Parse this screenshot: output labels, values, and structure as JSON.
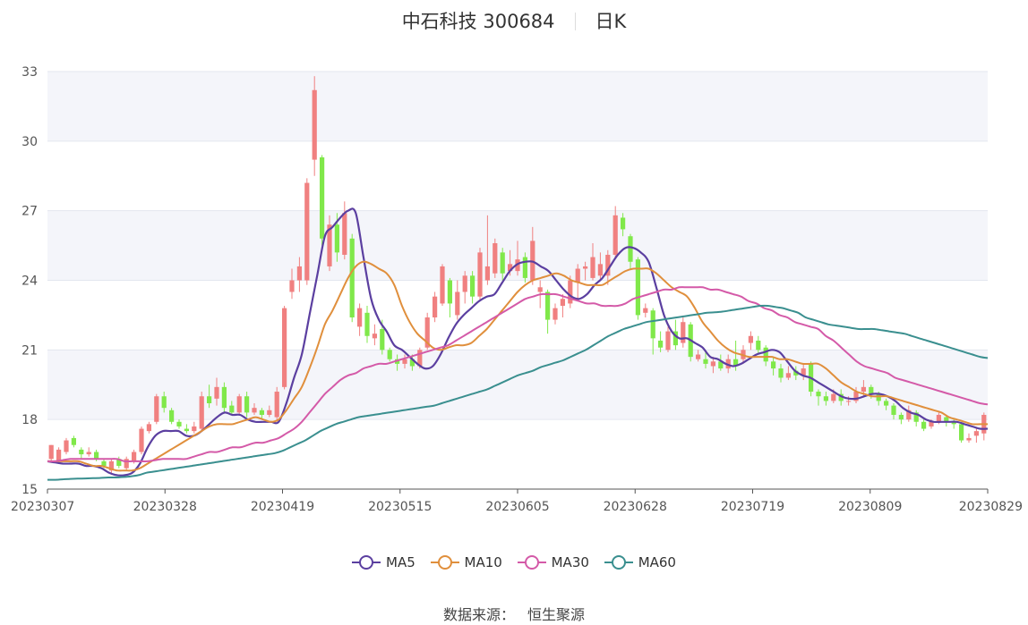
{
  "header": {
    "title": "中石科技 300684",
    "period": "日K"
  },
  "source": {
    "label": "数据来源：",
    "value": "恒生聚源"
  },
  "chart_data": {
    "type": "candlestick",
    "ylim": [
      15,
      33
    ],
    "yticks": [
      "15",
      "18",
      "21",
      "24",
      "27",
      "30",
      "33"
    ],
    "xticks": [
      "20230307",
      "20230328",
      "20230419",
      "20230515",
      "20230605",
      "20230628",
      "20230719",
      "20230809",
      "20230829"
    ],
    "grid": true,
    "legend_position": "bottom-center",
    "colors": {
      "up": "#f08080",
      "down": "#80e84a",
      "MA5": "#5b3fa0",
      "MA10": "#e08f3c",
      "MA30": "#d45aa8",
      "MA60": "#3a8f8f",
      "band": "#f4f5fa"
    },
    "series": [
      {
        "name": "MA5",
        "values": [
          16.2,
          16.15,
          16.1,
          16.1,
          16.1,
          16.0,
          16.0,
          15.9,
          15.7,
          15.6,
          15.6,
          15.7,
          16.1,
          16.8,
          17.3,
          17.5,
          17.5,
          17.5,
          17.3,
          17.3,
          17.5,
          17.8,
          18.1,
          18.3,
          18.2,
          18.2,
          18.0,
          17.9,
          17.9,
          17.9,
          17.9,
          18.7,
          19.8,
          20.8,
          22.5,
          24.2,
          25.9,
          26.3,
          26.7,
          27.0,
          26.9,
          25.0,
          23.2,
          22.3,
          21.8,
          21.2,
          21.0,
          20.7,
          20.4,
          20.2,
          20.3,
          20.8,
          21.5,
          22.1,
          22.5,
          22.8,
          23.1,
          23.3,
          23.4,
          23.9,
          24.4,
          24.7,
          24.8,
          24.8,
          24.6,
          24.4,
          24.0,
          23.6,
          23.3,
          23.2,
          23.4,
          23.8,
          24.1,
          24.6,
          25.1,
          25.4,
          25.4,
          25.2,
          24.8,
          23.7,
          22.5,
          21.8,
          21.5,
          21.5,
          21.3,
          21.1,
          20.7,
          20.6,
          20.4,
          20.3,
          20.4,
          20.6,
          20.8,
          20.9,
          21.0,
          20.9,
          20.5,
          20.1,
          19.9,
          19.8,
          19.6,
          19.4,
          19.2,
          19.0,
          18.9,
          18.9,
          19.0,
          19.1,
          19.1,
          19.0,
          18.8,
          18.5,
          18.3,
          18.2,
          18.0,
          17.9,
          17.9,
          17.9,
          17.9,
          17.8,
          17.7,
          17.6,
          17.6
        ]
      },
      {
        "name": "MA10",
        "values": [
          16.2,
          16.2,
          16.2,
          16.2,
          16.2,
          16.1,
          16.0,
          16.0,
          15.9,
          15.8,
          15.8,
          15.8,
          15.9,
          16.1,
          16.3,
          16.5,
          16.7,
          16.9,
          17.1,
          17.3,
          17.5,
          17.7,
          17.8,
          17.8,
          17.8,
          17.9,
          18.0,
          18.1,
          18.0,
          17.9,
          18.0,
          18.4,
          18.9,
          19.4,
          20.2,
          21.1,
          22.1,
          22.7,
          23.4,
          24.1,
          24.6,
          24.8,
          24.7,
          24.5,
          24.3,
          23.8,
          22.9,
          22.2,
          21.7,
          21.4,
          21.1,
          21.0,
          21.1,
          21.2,
          21.2,
          21.3,
          21.6,
          21.9,
          22.3,
          22.7,
          23.1,
          23.5,
          23.8,
          24.0,
          24.1,
          24.2,
          24.3,
          24.2,
          24.0,
          23.9,
          23.8,
          23.8,
          23.8,
          24.0,
          24.2,
          24.4,
          24.5,
          24.5,
          24.5,
          24.3,
          24.0,
          23.7,
          23.5,
          23.3,
          22.8,
          22.2,
          21.8,
          21.4,
          21.1,
          20.9,
          20.8,
          20.7,
          20.7,
          20.7,
          20.7,
          20.6,
          20.6,
          20.5,
          20.4,
          20.4,
          20.4,
          20.2,
          19.9,
          19.6,
          19.4,
          19.2,
          19.1,
          19.0,
          19.0,
          19.0,
          18.9,
          18.8,
          18.7,
          18.6,
          18.5,
          18.4,
          18.3,
          18.1,
          18.0,
          17.9,
          17.8,
          17.8,
          17.8
        ]
      },
      {
        "name": "MA30",
        "values": [
          16.2,
          16.2,
          16.25,
          16.3,
          16.3,
          16.3,
          16.3,
          16.3,
          16.3,
          16.3,
          16.2,
          16.2,
          16.2,
          16.2,
          16.25,
          16.3,
          16.3,
          16.3,
          16.3,
          16.4,
          16.5,
          16.6,
          16.6,
          16.7,
          16.8,
          16.8,
          16.9,
          17.0,
          17.0,
          17.1,
          17.2,
          17.4,
          17.6,
          17.9,
          18.3,
          18.7,
          19.1,
          19.4,
          19.7,
          19.9,
          20.0,
          20.2,
          20.3,
          20.4,
          20.4,
          20.5,
          20.6,
          20.7,
          20.8,
          20.9,
          21.0,
          21.1,
          21.2,
          21.4,
          21.6,
          21.8,
          22.0,
          22.2,
          22.4,
          22.6,
          22.8,
          23.0,
          23.2,
          23.3,
          23.4,
          23.4,
          23.4,
          23.3,
          23.2,
          23.1,
          23.0,
          23.0,
          22.9,
          22.9,
          22.9,
          23.0,
          23.2,
          23.3,
          23.4,
          23.5,
          23.6,
          23.6,
          23.7,
          23.7,
          23.7,
          23.7,
          23.6,
          23.6,
          23.5,
          23.4,
          23.3,
          23.1,
          23.0,
          22.8,
          22.7,
          22.5,
          22.4,
          22.2,
          22.1,
          22.0,
          21.9,
          21.6,
          21.4,
          21.1,
          20.8,
          20.5,
          20.3,
          20.2,
          20.1,
          20.0,
          19.8,
          19.7,
          19.6,
          19.5,
          19.4,
          19.3,
          19.2,
          19.1,
          19.0,
          18.9,
          18.8,
          18.7,
          18.65
        ]
      },
      {
        "name": "MA60",
        "values": [
          15.4,
          15.4,
          15.42,
          15.44,
          15.45,
          15.46,
          15.47,
          15.48,
          15.5,
          15.5,
          15.52,
          15.55,
          15.6,
          15.7,
          15.75,
          15.8,
          15.85,
          15.9,
          15.95,
          16.0,
          16.05,
          16.1,
          16.15,
          16.2,
          16.25,
          16.3,
          16.35,
          16.4,
          16.45,
          16.5,
          16.55,
          16.65,
          16.8,
          16.95,
          17.1,
          17.3,
          17.5,
          17.65,
          17.8,
          17.9,
          18.0,
          18.1,
          18.15,
          18.2,
          18.25,
          18.3,
          18.35,
          18.4,
          18.45,
          18.5,
          18.55,
          18.6,
          18.7,
          18.8,
          18.9,
          19.0,
          19.1,
          19.2,
          19.3,
          19.45,
          19.6,
          19.75,
          19.9,
          20.0,
          20.1,
          20.25,
          20.35,
          20.45,
          20.55,
          20.7,
          20.85,
          21.0,
          21.2,
          21.4,
          21.6,
          21.75,
          21.9,
          22.0,
          22.1,
          22.2,
          22.25,
          22.3,
          22.35,
          22.4,
          22.45,
          22.5,
          22.55,
          22.6,
          22.62,
          22.65,
          22.7,
          22.75,
          22.8,
          22.85,
          22.9,
          22.9,
          22.85,
          22.8,
          22.7,
          22.6,
          22.4,
          22.3,
          22.2,
          22.1,
          22.05,
          22.0,
          21.95,
          21.9,
          21.9,
          21.9,
          21.85,
          21.8,
          21.75,
          21.7,
          21.6,
          21.5,
          21.4,
          21.3,
          21.2,
          21.1,
          21.0,
          20.9,
          20.8,
          20.7,
          20.65
        ]
      }
    ],
    "candles": [
      [
        16.3,
        16.9,
        16.9,
        16.2
      ],
      [
        16.2,
        16.7,
        16.8,
        16.1
      ],
      [
        16.6,
        17.1,
        17.2,
        16.5
      ],
      [
        17.2,
        16.9,
        17.3,
        16.8
      ],
      [
        16.7,
        16.5,
        16.8,
        16.3
      ],
      [
        16.5,
        16.6,
        16.8,
        16.4
      ],
      [
        16.6,
        16.3,
        16.7,
        16.2
      ],
      [
        16.2,
        16.0,
        16.3,
        15.9
      ],
      [
        15.8,
        16.2,
        16.3,
        15.7
      ],
      [
        16.3,
        16.0,
        16.4,
        15.9
      ],
      [
        15.9,
        16.3,
        16.4,
        15.8
      ],
      [
        16.2,
        16.6,
        16.7,
        16.1
      ],
      [
        16.6,
        17.6,
        17.7,
        16.5
      ],
      [
        17.5,
        17.8,
        17.9,
        17.4
      ],
      [
        17.9,
        19.0,
        19.1,
        17.8
      ],
      [
        19.0,
        18.5,
        19.2,
        18.3
      ],
      [
        18.4,
        17.9,
        18.5,
        17.8
      ],
      [
        17.9,
        17.7,
        18.0,
        17.6
      ],
      [
        17.6,
        17.5,
        17.8,
        17.4
      ],
      [
        17.5,
        17.7,
        17.9,
        17.4
      ],
      [
        17.6,
        19.0,
        19.2,
        17.5
      ],
      [
        19.0,
        18.7,
        19.5,
        18.5
      ],
      [
        18.9,
        19.4,
        19.8,
        18.6
      ],
      [
        19.4,
        18.5,
        19.6,
        18.3
      ],
      [
        18.6,
        18.3,
        18.8,
        18.2
      ],
      [
        18.3,
        19.0,
        19.1,
        18.2
      ],
      [
        19.0,
        18.3,
        19.2,
        18.1
      ],
      [
        18.3,
        18.5,
        18.7,
        18.2
      ],
      [
        18.4,
        18.2,
        18.5,
        18.0
      ],
      [
        18.2,
        18.4,
        18.6,
        18.1
      ],
      [
        18.1,
        19.2,
        19.4,
        17.9
      ],
      [
        19.4,
        22.8,
        22.9,
        19.3
      ],
      [
        23.5,
        24.0,
        24.5,
        23.2
      ],
      [
        24.0,
        24.6,
        25.0,
        23.5
      ],
      [
        24.0,
        28.2,
        28.4,
        23.8
      ],
      [
        29.2,
        32.2,
        32.8,
        28.5
      ],
      [
        29.3,
        25.8,
        29.4,
        25.5
      ],
      [
        24.6,
        26.4,
        26.8,
        24.4
      ],
      [
        26.4,
        25.2,
        26.9,
        24.8
      ],
      [
        25.1,
        26.9,
        27.4,
        24.9
      ],
      [
        25.8,
        22.4,
        26.0,
        22.2
      ],
      [
        22.0,
        22.8,
        23.0,
        21.6
      ],
      [
        22.6,
        21.6,
        22.9,
        21.3
      ],
      [
        21.5,
        21.7,
        22.1,
        21.2
      ],
      [
        21.9,
        21.0,
        22.3,
        20.8
      ],
      [
        21.0,
        20.6,
        21.1,
        20.5
      ],
      [
        20.6,
        20.4,
        20.8,
        20.1
      ],
      [
        20.4,
        20.6,
        20.8,
        20.2
      ],
      [
        20.6,
        20.3,
        20.8,
        20.1
      ],
      [
        20.3,
        21.0,
        21.1,
        20.2
      ],
      [
        21.1,
        22.4,
        22.6,
        21.0
      ],
      [
        22.4,
        23.3,
        23.5,
        22.2
      ],
      [
        23.0,
        24.6,
        24.7,
        22.9
      ],
      [
        24.0,
        23.0,
        24.1,
        22.4
      ],
      [
        22.5,
        23.5,
        24.0,
        22.3
      ],
      [
        23.5,
        24.2,
        24.4,
        23.0
      ],
      [
        24.2,
        23.3,
        24.4,
        23.0
      ],
      [
        23.3,
        25.2,
        25.4,
        23.1
      ],
      [
        24.0,
        24.6,
        26.8,
        23.8
      ],
      [
        24.3,
        25.6,
        25.8,
        24.1
      ],
      [
        25.2,
        24.3,
        25.4,
        24.0
      ],
      [
        24.4,
        24.7,
        25.3,
        24.2
      ],
      [
        24.4,
        24.9,
        25.7,
        24.2
      ],
      [
        25.0,
        24.1,
        25.2,
        23.9
      ],
      [
        24.0,
        25.7,
        26.3,
        23.8
      ],
      [
        23.5,
        23.7,
        24.0,
        22.8
      ],
      [
        23.5,
        22.3,
        23.6,
        21.7
      ],
      [
        22.3,
        22.8,
        23.0,
        22.1
      ],
      [
        22.9,
        23.2,
        23.4,
        22.4
      ],
      [
        23.0,
        24.0,
        24.2,
        22.8
      ],
      [
        23.9,
        24.5,
        24.7,
        23.2
      ],
      [
        24.5,
        24.6,
        24.8,
        24.0
      ],
      [
        24.1,
        25.0,
        25.6,
        24.0
      ],
      [
        24.2,
        24.7,
        25.2,
        24.0
      ],
      [
        24.2,
        25.1,
        25.3,
        23.8
      ],
      [
        25.1,
        26.8,
        27.2,
        25.0
      ],
      [
        26.7,
        26.2,
        26.9,
        25.9
      ],
      [
        25.9,
        24.8,
        26.0,
        24.5
      ],
      [
        24.9,
        22.5,
        25.0,
        22.3
      ],
      [
        22.6,
        22.8,
        23.0,
        22.4
      ],
      [
        22.7,
        21.5,
        22.8,
        20.8
      ],
      [
        21.4,
        21.1,
        21.8,
        20.9
      ],
      [
        21.0,
        21.8,
        22.0,
        20.9
      ],
      [
        21.8,
        21.2,
        22.3,
        21.0
      ],
      [
        21.3,
        22.2,
        22.4,
        21.1
      ],
      [
        22.1,
        20.7,
        22.2,
        20.5
      ],
      [
        20.6,
        20.8,
        21.0,
        20.5
      ],
      [
        20.6,
        20.4,
        20.9,
        20.2
      ],
      [
        20.3,
        20.5,
        20.7,
        20.0
      ],
      [
        20.5,
        20.2,
        20.8,
        20.1
      ],
      [
        20.2,
        20.6,
        20.8,
        20.0
      ],
      [
        20.6,
        20.3,
        21.4,
        20.1
      ],
      [
        20.6,
        21.0,
        21.2,
        20.4
      ],
      [
        21.3,
        21.6,
        21.8,
        21.0
      ],
      [
        21.4,
        21.0,
        21.6,
        20.8
      ],
      [
        21.1,
        20.5,
        21.2,
        20.3
      ],
      [
        20.5,
        20.2,
        20.7,
        19.9
      ],
      [
        20.2,
        19.8,
        20.4,
        19.6
      ],
      [
        19.8,
        20.0,
        20.3,
        19.7
      ],
      [
        20.1,
        19.9,
        20.3,
        19.7
      ],
      [
        19.9,
        20.2,
        20.4,
        19.7
      ],
      [
        20.4,
        19.2,
        20.5,
        19.0
      ],
      [
        19.2,
        19.0,
        19.3,
        18.6
      ],
      [
        19.0,
        18.8,
        19.2,
        18.6
      ],
      [
        18.8,
        19.1,
        19.3,
        18.7
      ],
      [
        19.1,
        18.8,
        19.3,
        18.6
      ],
      [
        18.8,
        18.8,
        19.0,
        18.6
      ],
      [
        18.8,
        19.2,
        19.4,
        18.7
      ],
      [
        19.2,
        19.4,
        19.7,
        19.0
      ],
      [
        19.4,
        19.1,
        19.5,
        18.9
      ],
      [
        19.1,
        18.8,
        19.2,
        18.6
      ],
      [
        18.8,
        18.6,
        18.9,
        18.4
      ],
      [
        18.6,
        18.2,
        18.7,
        18.0
      ],
      [
        18.2,
        18.0,
        18.3,
        17.8
      ],
      [
        18.0,
        18.4,
        18.6,
        17.9
      ],
      [
        18.3,
        17.9,
        18.4,
        17.7
      ],
      [
        17.9,
        17.6,
        18.0,
        17.5
      ],
      [
        17.7,
        17.9,
        18.0,
        17.6
      ],
      [
        17.9,
        18.2,
        18.3,
        17.8
      ],
      [
        18.1,
        17.9,
        18.2,
        17.7
      ],
      [
        17.9,
        17.8,
        18.0,
        17.6
      ],
      [
        17.8,
        17.1,
        17.9,
        17.0
      ],
      [
        17.1,
        17.2,
        17.4,
        17.0
      ],
      [
        17.3,
        17.5,
        17.6,
        17.0
      ],
      [
        17.4,
        18.2,
        18.3,
        17.1
      ]
    ]
  }
}
